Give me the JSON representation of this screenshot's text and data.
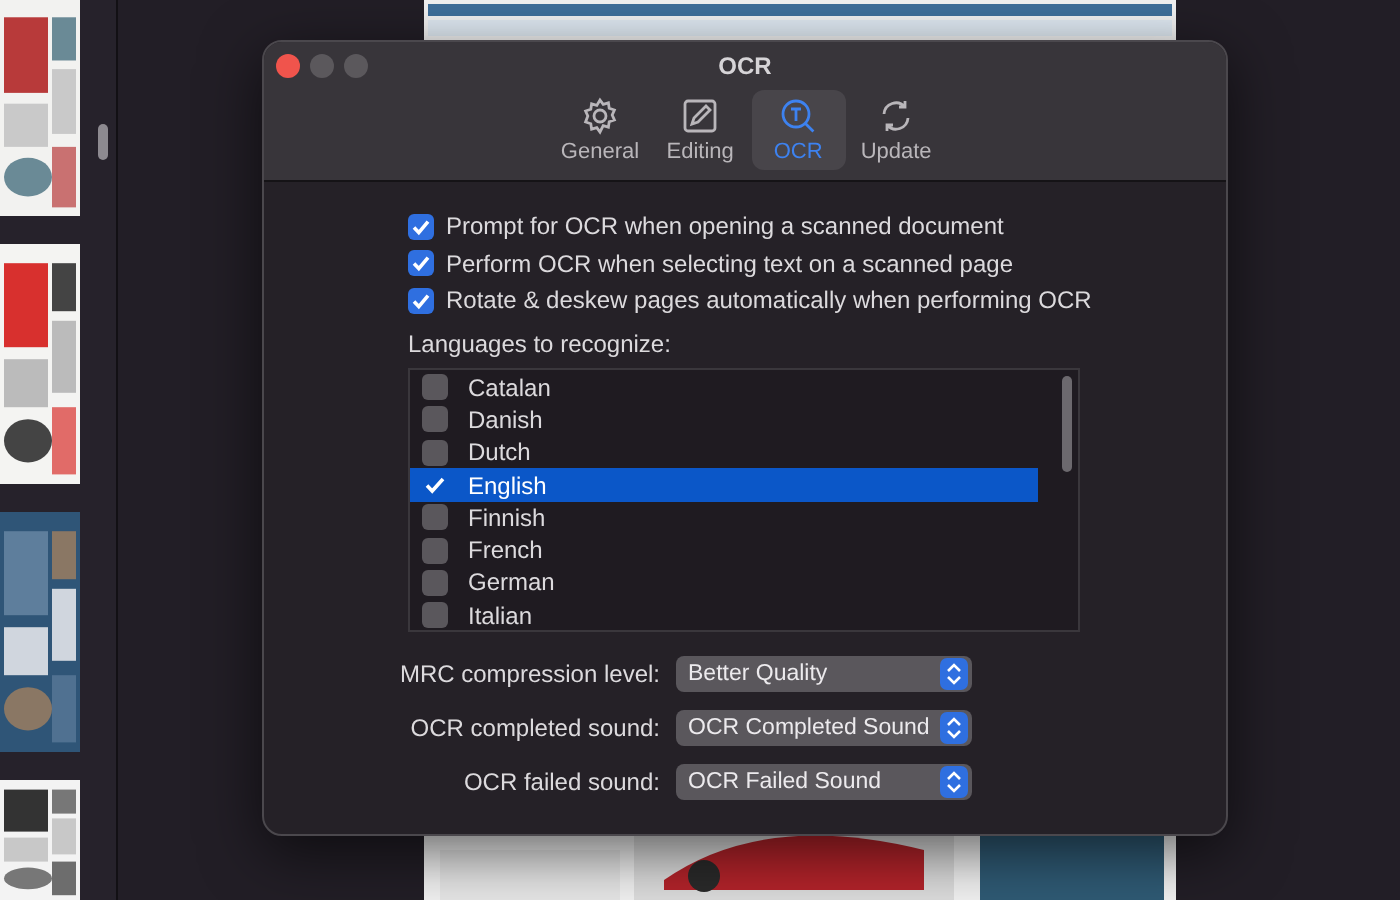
{
  "window": {
    "title": "OCR"
  },
  "tabs": [
    {
      "label": "General",
      "kind": "gear",
      "selected": false
    },
    {
      "label": "Editing",
      "kind": "pencil",
      "selected": false
    },
    {
      "label": "OCR",
      "kind": "magnifier",
      "selected": true
    },
    {
      "label": "Update",
      "kind": "sync",
      "selected": false
    }
  ],
  "options": [
    {
      "label": "Prompt for OCR when opening a scanned document",
      "checked": true
    },
    {
      "label": "Perform OCR when selecting text on a scanned page",
      "checked": true
    },
    {
      "label": "Rotate & deskew pages automatically when performing OCR",
      "checked": true
    }
  ],
  "languages_label": "Languages to recognize:",
  "languages": [
    {
      "label": "Catalan",
      "checked": false,
      "selected": false
    },
    {
      "label": "Danish",
      "checked": false,
      "selected": false
    },
    {
      "label": "Dutch",
      "checked": false,
      "selected": false
    },
    {
      "label": "English",
      "checked": true,
      "selected": true
    },
    {
      "label": "Finnish",
      "checked": false,
      "selected": false
    },
    {
      "label": "French",
      "checked": false,
      "selected": false
    },
    {
      "label": "German",
      "checked": false,
      "selected": false
    },
    {
      "label": "Italian",
      "checked": false,
      "selected": false
    }
  ],
  "popups": [
    {
      "label": "MRC compression level:",
      "value": "Better Quality"
    },
    {
      "label": "OCR completed sound:",
      "value": "OCR Completed Sound"
    },
    {
      "label": "OCR failed sound:",
      "value": "OCR Failed Sound"
    }
  ]
}
